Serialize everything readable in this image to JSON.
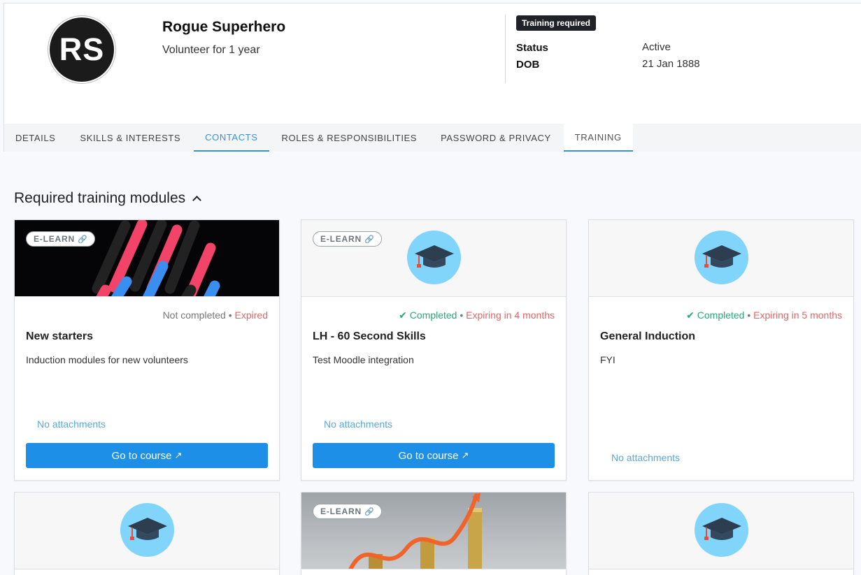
{
  "profile": {
    "initials": "RS",
    "name": "Rogue Superhero",
    "tenure": "Volunteer for 1 year",
    "badge": "Training required",
    "status_label": "Status",
    "status_value": "Active",
    "dob_label": "DOB",
    "dob_value": "21 Jan 1888"
  },
  "tabs": [
    {
      "label": "DETAILS"
    },
    {
      "label": "SKILLS & INTERESTS"
    },
    {
      "label": "CONTACTS"
    },
    {
      "label": "ROLES & RESPONSIBILITIES"
    },
    {
      "label": "PASSWORD & PRIVACY"
    },
    {
      "label": "TRAINING"
    }
  ],
  "section": {
    "title": "Required training modules"
  },
  "cards": [
    {
      "tag": "E-LEARN",
      "status": "Not completed",
      "separator": "•",
      "expiry": "Expired",
      "title": "New starters",
      "description": "Induction modules for new volunteers",
      "attachments": "No attachments",
      "button": "Go to course"
    },
    {
      "tag": "E-LEARN",
      "status_icon": "✔",
      "status": "Completed",
      "separator": "•",
      "expiry": "Expiring in 4 months",
      "title": "LH - 60 Second Skills",
      "description": "Test Moodle integration",
      "attachments": "No attachments",
      "button": "Go to course"
    },
    {
      "status_icon": "✔",
      "status": "Completed",
      "separator": "•",
      "expiry": "Expiring in 5 months",
      "title": "General Induction",
      "description": "FYI",
      "attachments": "No attachments"
    },
    {},
    {
      "tag": "E-LEARN"
    },
    {}
  ],
  "icons": {
    "tag": "link-icon",
    "button": "external-link-icon",
    "module": "graduation-cap-icon",
    "collapse": "chevron-up-icon"
  },
  "colors": {
    "accent": "#1e8fe6",
    "tab_active": "#3a91d6",
    "completed": "#28a77a",
    "expired": "#e06666",
    "cap_circle": "#81d5fb"
  }
}
